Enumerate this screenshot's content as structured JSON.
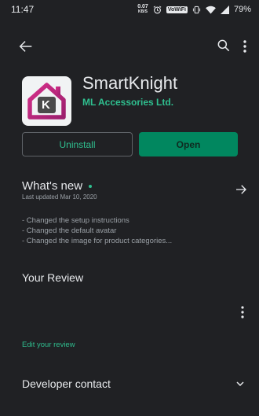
{
  "status": {
    "time": "11:47",
    "netspeed_value": "0.07",
    "netspeed_unit": "KB/S",
    "vowifi": "VoWiFi",
    "battery": "79%"
  },
  "icons": {
    "back": "arrow-back-icon",
    "search": "search-icon",
    "more": "more-vert-icon",
    "whats_new_arrow": "arrow-forward-icon",
    "expand": "chevron-down-icon"
  },
  "app": {
    "title": "SmartKnight",
    "developer": "ML Accessories Ltd.",
    "icon_letter": "K",
    "accent": "#2fbf8f"
  },
  "buttons": {
    "uninstall": "Uninstall",
    "open": "Open"
  },
  "whats_new": {
    "title": "What's new",
    "bullet": "•",
    "last_updated": "Last updated Mar 10, 2020",
    "changes": [
      "- Changed the setup instructions",
      "- Changed the default avatar",
      "- Changed the image for product categories..."
    ]
  },
  "review": {
    "title": "Your Review",
    "edit_label": "Edit your review"
  },
  "developer_contact": {
    "title": "Developer contact"
  }
}
